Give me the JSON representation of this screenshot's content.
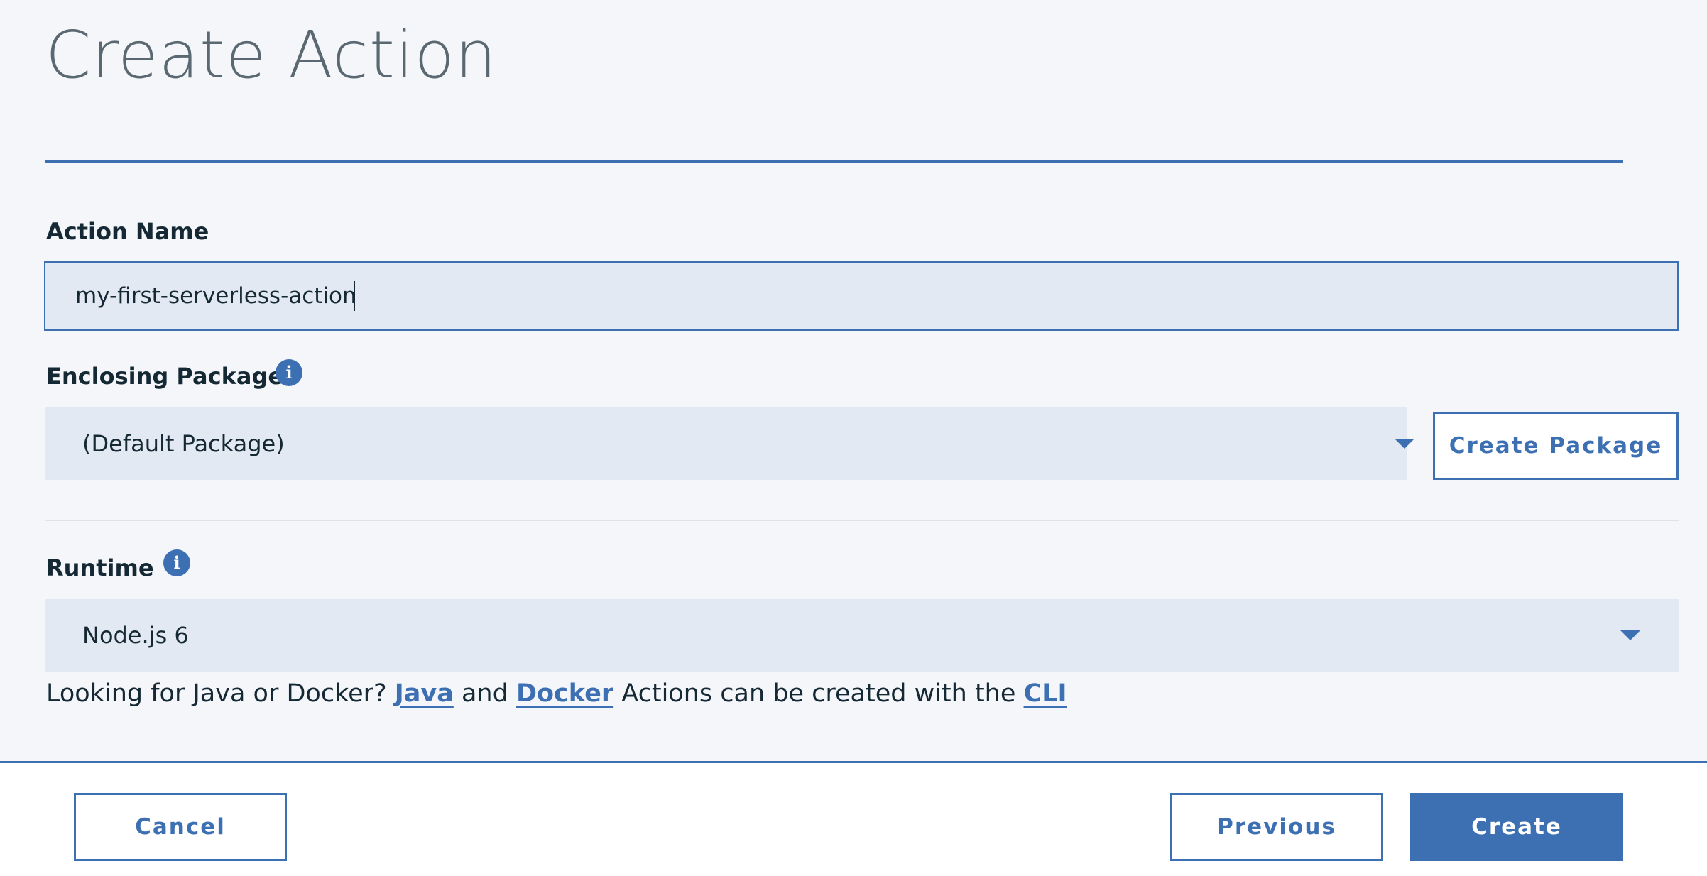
{
  "header": {
    "title": "Create Action"
  },
  "action_name": {
    "label": "Action Name",
    "value": "my-first-serverless-action",
    "placeholder": ""
  },
  "enclosing_package": {
    "label": "Enclosing Package",
    "info_icon": "info-icon",
    "selected": "(Default Package)",
    "create_button": "Create Package"
  },
  "runtime": {
    "label": "Runtime",
    "info_icon": "info-icon",
    "selected": "Node.js 6"
  },
  "helper": {
    "prefix": "Looking for Java or Docker?",
    "java_link": "Java",
    "and_text": "and",
    "docker_link": "Docker",
    "middle_text": "Actions can be created with the",
    "cli_link": "CLI"
  },
  "footer": {
    "cancel": "Cancel",
    "previous": "Previous",
    "create": "Create"
  },
  "colors": {
    "accent": "#3d70b2",
    "background": "#f4f6fa",
    "field_background": "#e3e9f2",
    "text": "#152935",
    "title": "#5a6872"
  }
}
